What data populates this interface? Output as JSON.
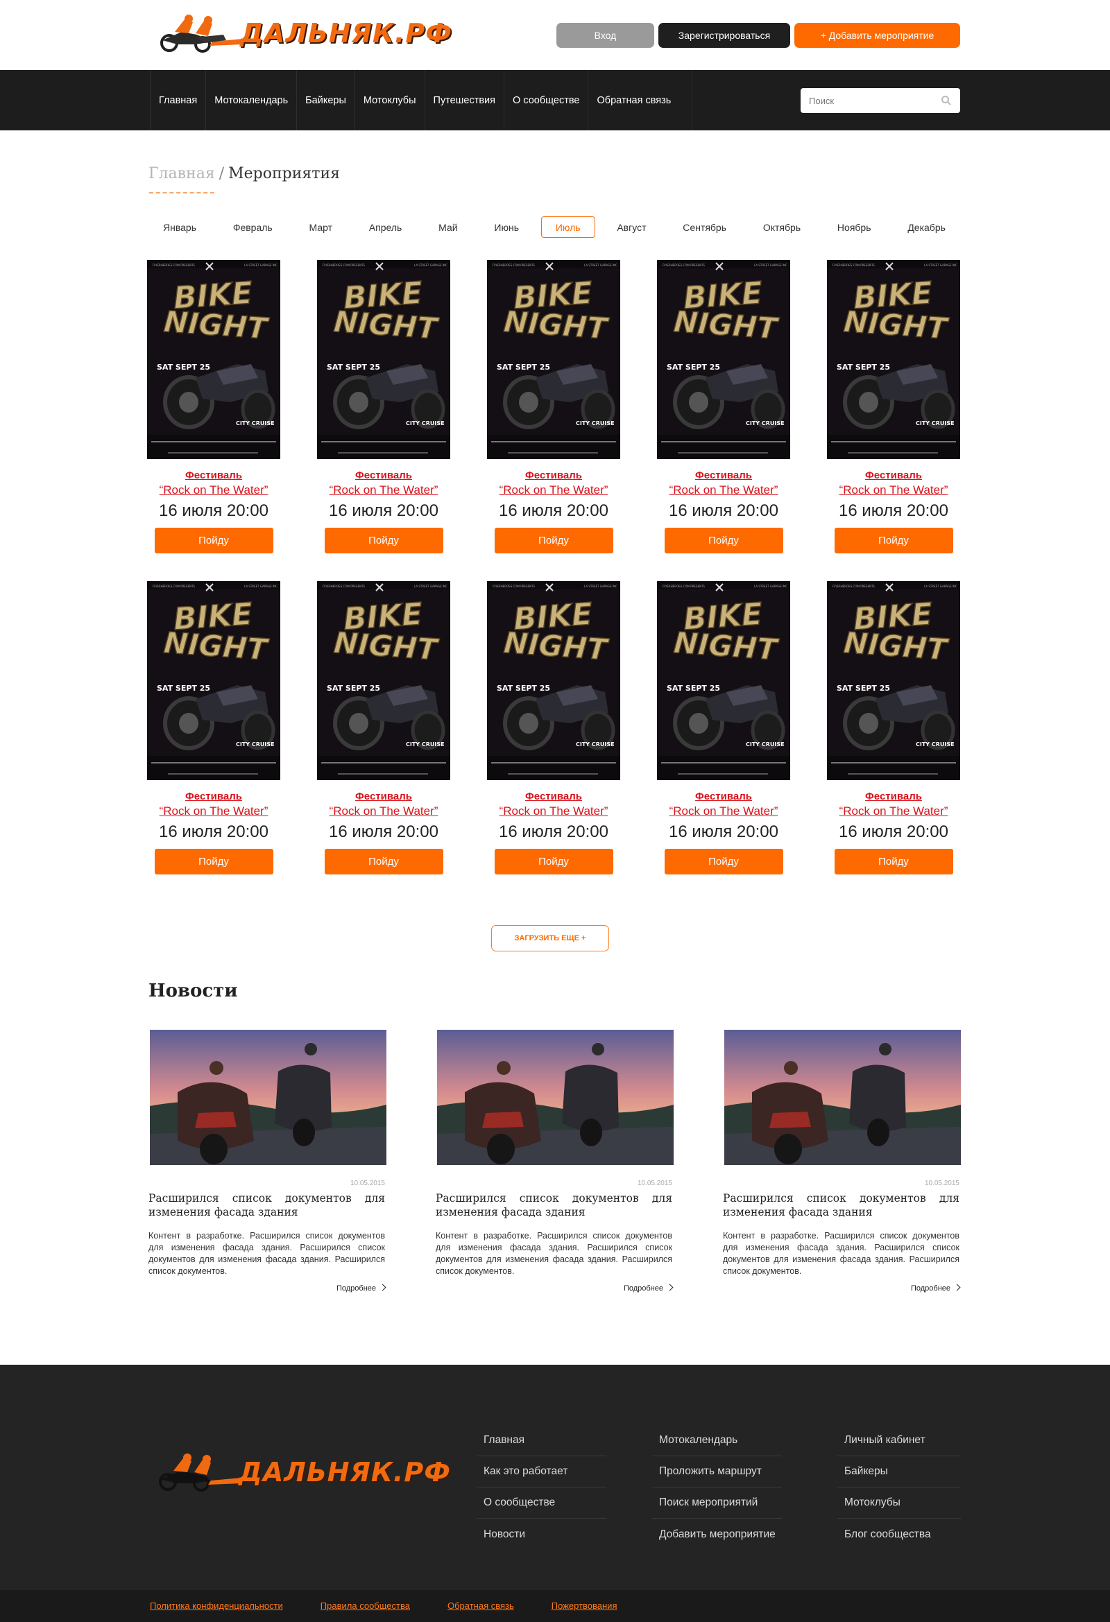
{
  "brand": {
    "name": "ДАЛЬНЯК.РФ",
    "accent": "#ff6a00",
    "dark": "#1d1d1d"
  },
  "header": {
    "login": "Вход",
    "register": "Зарегистрироваться",
    "add_event": "+ Добавить мероприятие"
  },
  "nav": [
    "Главная",
    "Мотокалендарь",
    "Байкеры",
    "Мотоклубы",
    "Путешествия",
    "О сообществе",
    "Обратная связь"
  ],
  "search": {
    "placeholder": "Поиск",
    "icon": "search-icon"
  },
  "breadcrumb": {
    "home": "Главная",
    "separator": "/",
    "current": "Мероприятия"
  },
  "months": [
    "Январь",
    "Февраль",
    "Март",
    "Апрель",
    "Май",
    "Июнь",
    "Июль",
    "Август",
    "Сентябрь",
    "Октябрь",
    "Ноябрь",
    "Декабрь"
  ],
  "active_month": "Июль",
  "events": [
    {
      "type": "Фестиваль",
      "title": "“Rock on The Water”",
      "date": "16 июля 20:00",
      "button": "Пойду"
    },
    {
      "type": "Фестиваль",
      "title": "“Rock on The Water”",
      "date": "16 июля 20:00",
      "button": "Пойду"
    },
    {
      "type": "Фестиваль",
      "title": "“Rock on The Water”",
      "date": "16 июля 20:00",
      "button": "Пойду"
    },
    {
      "type": "Фестиваль",
      "title": "“Rock on The Water”",
      "date": "16 июля 20:00",
      "button": "Пойду"
    },
    {
      "type": "Фестиваль",
      "title": "“Rock on The Water”",
      "date": "16 июля 20:00",
      "button": "Пойду"
    },
    {
      "type": "Фестиваль",
      "title": "“Rock on The Water”",
      "date": "16 июля 20:00",
      "button": "Пойду"
    },
    {
      "type": "Фестиваль",
      "title": "“Rock on The Water”",
      "date": "16 июля 20:00",
      "button": "Пойду"
    },
    {
      "type": "Фестиваль",
      "title": "“Rock on The Water”",
      "date": "16 июля 20:00",
      "button": "Пойду"
    },
    {
      "type": "Фестиваль",
      "title": "“Rock on The Water”",
      "date": "16 июля 20:00",
      "button": "Пойду"
    },
    {
      "type": "Фестиваль",
      "title": "“Rock on The Water”",
      "date": "16 июля 20:00",
      "button": "Пойду"
    }
  ],
  "poster": {
    "line1": "BIKE",
    "line2": "NIGHT",
    "date": "SAT SEPT 25",
    "sub": "CITY CRUISE"
  },
  "load_more": "ЗАГРУЗИТЬ ЕЩЕ +",
  "news": {
    "title": "Новости",
    "items": [
      {
        "date": "10.05.2015",
        "headline": "Расширился список документов для изменения фасада здания",
        "body": "Контент в разработке. Расширился список документов для изменения фасада здания. Расширился список документов для изменения фасада здания. Расширился список документов.",
        "more": "Подробнее"
      },
      {
        "date": "10.05.2015",
        "headline": "Расширился список документов для изменения фасада здания",
        "body": "Контент в разработке. Расширился список документов для изменения фасада здания. Расширился список документов для изменения фасада здания. Расширился список документов.",
        "more": "Подробнее"
      },
      {
        "date": "10.05.2015",
        "headline": "Расширился список документов для изменения фасада здания",
        "body": "Контент в разработке. Расширился список документов для изменения фасада здания. Расширился список документов для изменения фасада здания. Расширился список документов.",
        "more": "Подробнее"
      }
    ]
  },
  "footer": {
    "col1": [
      "Главная",
      "Как это работает",
      "О сообществе",
      "Новости"
    ],
    "col2": [
      "Мотокалендарь",
      "Проложить маршрут",
      "Поиск мероприятий",
      "Добавить мероприятие"
    ],
    "col3": [
      "Личный кабинет",
      "Байкеры",
      "Мотоклубы",
      "Блог сообщества"
    ],
    "bottom_links": [
      "Политика конфиденциальности",
      "Правила сообщества",
      "Обратная связь",
      "Пожертвования"
    ]
  }
}
